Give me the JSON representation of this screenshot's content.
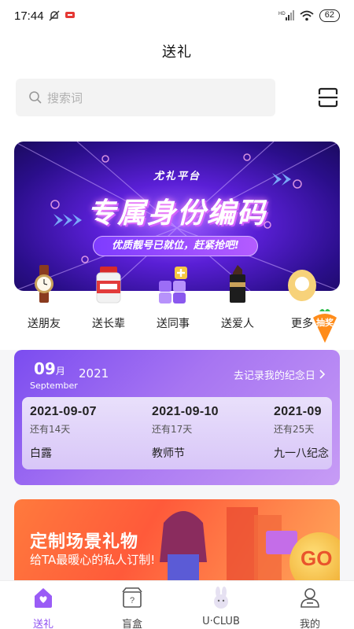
{
  "status_bar": {
    "time": "17:44",
    "battery": "62"
  },
  "header": {
    "title": "送礼"
  },
  "search": {
    "placeholder": "搜索词"
  },
  "banner": {
    "brand": "尤礼平台",
    "title": "专属身份编码",
    "pill": "优质靓号已就位，赶紧抢吧!"
  },
  "categories": [
    {
      "label": "送朋友",
      "icon": "watch-icon"
    },
    {
      "label": "送长辈",
      "icon": "supplement-bottle-icon"
    },
    {
      "label": "送同事",
      "icon": "blocks-icon"
    },
    {
      "label": "送爱人",
      "icon": "lipstick-icon"
    },
    {
      "label": "更多",
      "icon": "more-icon"
    }
  ],
  "draw_badge": {
    "label": "抽奖"
  },
  "anniversary": {
    "month": "09",
    "month_unit": "月",
    "month_en": "September",
    "year": "2021",
    "link": "去记录我的纪念日",
    "events": [
      {
        "date": "2021-09-07",
        "remaining": "还有14天",
        "name": "白露"
      },
      {
        "date": "2021-09-10",
        "remaining": "还有17天",
        "name": "教师节"
      },
      {
        "date": "2021-09",
        "remaining": "还有25天",
        "name": "九一八纪念"
      }
    ]
  },
  "promo": {
    "title": "定制场景礼物",
    "subtitle": "给TA最暖心的私人订制!",
    "go": "GO"
  },
  "tabbar": [
    {
      "label": "送礼",
      "active": true
    },
    {
      "label": "盲盒",
      "active": false
    },
    {
      "label": "U·CLUB",
      "active": false
    },
    {
      "label": "我的",
      "active": false
    }
  ],
  "colors": {
    "accent": "#8f4ff0",
    "banner": "#5a1fd6",
    "promo": "#ff5a3a"
  }
}
